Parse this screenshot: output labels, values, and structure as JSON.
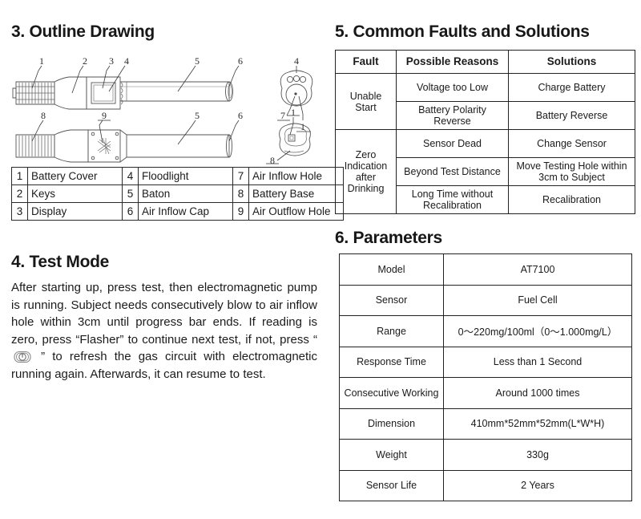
{
  "document": {
    "background": "#ffffff",
    "ink": "#1b1b1b"
  },
  "sections": {
    "outline": {
      "title": "3. Outline Drawing",
      "top_view_callouts": [
        "1",
        "2",
        "3",
        "4",
        "5",
        "6"
      ],
      "bottom_view_callouts": [
        "8",
        "9",
        "5",
        "6"
      ],
      "top_end_view_callouts": [
        "4",
        "7",
        "1"
      ],
      "bottom_end_view_callouts": [
        "1",
        "8"
      ]
    },
    "parts": {
      "rows": [
        [
          {
            "num": "1",
            "label": "Battery Cover"
          },
          {
            "num": "4",
            "label": "Floodlight"
          },
          {
            "num": "7",
            "label": "Air Inflow Hole"
          }
        ],
        [
          {
            "num": "2",
            "label": "Keys"
          },
          {
            "num": "5",
            "label": "Baton"
          },
          {
            "num": "8",
            "label": "Battery Base"
          }
        ],
        [
          {
            "num": "3",
            "label": "Display"
          },
          {
            "num": "6",
            "label": "Air Inflow Cap"
          },
          {
            "num": "9",
            "label": "Air Outflow Hole"
          }
        ]
      ]
    },
    "test_mode": {
      "title": "4. Test Mode",
      "paragraph_part1": "After starting up, press test, then electromagnetic pump is running. Subject needs consecutively blow to air inflow hole within 3cm until progress bar ends. If reading is zero, press “Flasher” to continue next test, if not, press “ ",
      "icon_name": "power-button-icon",
      "paragraph_part2": " ” to refresh the gas circuit with electromagnetic running again. Afterwards, it can resume to test."
    },
    "faults": {
      "title": "5. Common Faults and Solutions",
      "headers": [
        "Fault",
        "Possible Reasons",
        "Solutions"
      ],
      "groups": [
        {
          "fault": "Unable Start",
          "rows": [
            {
              "reason": "Voltage too Low",
              "solution": "Charge Battery"
            },
            {
              "reason": "Battery Polarity Reverse",
              "solution": "Battery Reverse"
            }
          ]
        },
        {
          "fault": "Zero Indication after Drinking",
          "rows": [
            {
              "reason": "Sensor Dead",
              "solution": "Change Sensor"
            },
            {
              "reason": "Beyond Test Distance",
              "solution": "Move Testing Hole within 3cm to Subject"
            },
            {
              "reason": "Long Time without Recalibration",
              "solution": "Recalibration"
            }
          ]
        }
      ]
    },
    "parameters": {
      "title": "6. Parameters",
      "rows": [
        {
          "name": "Model",
          "value": "AT7100"
        },
        {
          "name": "Sensor",
          "value": "Fuel Cell"
        },
        {
          "name": "Range",
          "value": "0～220mg/100ml（0～1.000mg/L）"
        },
        {
          "name": "Response Time",
          "value": "Less than 1 Second"
        },
        {
          "name": "Consecutive Working",
          "value": "Around 1000 times"
        },
        {
          "name": "Dimension",
          "value": "410mm*52mm*52mm(L*W*H)"
        },
        {
          "name": "Weight",
          "value": "330g"
        },
        {
          "name": "Sensor Life",
          "value": "2 Years"
        }
      ]
    }
  }
}
